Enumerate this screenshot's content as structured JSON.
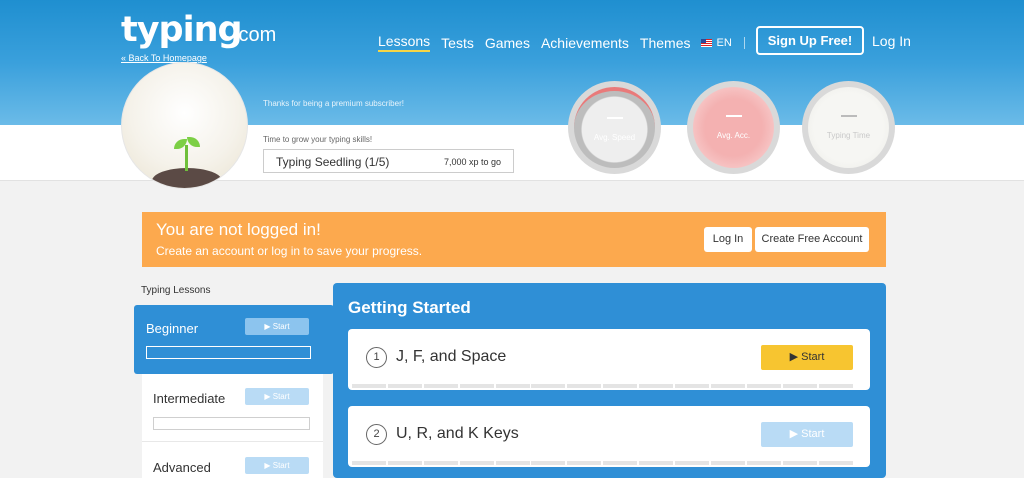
{
  "header": {
    "logo": "typing",
    "logo_domain": ".com",
    "back_link": "« Back To Homepage",
    "nav": [
      "Lessons",
      "Tests",
      "Games",
      "Achievements",
      "Themes"
    ],
    "language": "EN",
    "signup_label": "Sign Up Free!",
    "login_label": "Log In"
  },
  "profile": {
    "premium_message": "Thanks for being a premium subscriber!",
    "grow_message": "Time to grow your typing skills!",
    "level_name": "Typing Seedling (1/5)",
    "level_xp": "7,000 xp to go"
  },
  "stats": [
    {
      "value": "—",
      "label": "Avg. Speed"
    },
    {
      "value": "—",
      "label": "Avg. Acc."
    },
    {
      "value": "—",
      "label": "Typing Time"
    }
  ],
  "alert": {
    "title": "You are not logged in!",
    "subtitle": "Create an account or log in to save your progress.",
    "login_label": "Log In",
    "create_label": "Create Free Account"
  },
  "sidebar": {
    "heading": "Typing Lessons",
    "items": [
      {
        "label": "Beginner",
        "start": "▶ Start",
        "active": true
      },
      {
        "label": "Intermediate",
        "start": "▶ Start",
        "active": false
      },
      {
        "label": "Advanced",
        "start": "▶ Start",
        "active": false
      }
    ]
  },
  "main": {
    "title": "Getting Started",
    "lessons": [
      {
        "number": "1",
        "name": "J, F, and Space",
        "start": "▶  Start",
        "highlight": true
      },
      {
        "number": "2",
        "name": "U, R, and K Keys",
        "start": "▶  Start",
        "highlight": false
      }
    ]
  },
  "colors": {
    "brand_blue": "#2f8fd6",
    "alert_orange": "#fca94e",
    "start_yellow": "#f7c530",
    "start_disabled": "#b9dbf5"
  }
}
